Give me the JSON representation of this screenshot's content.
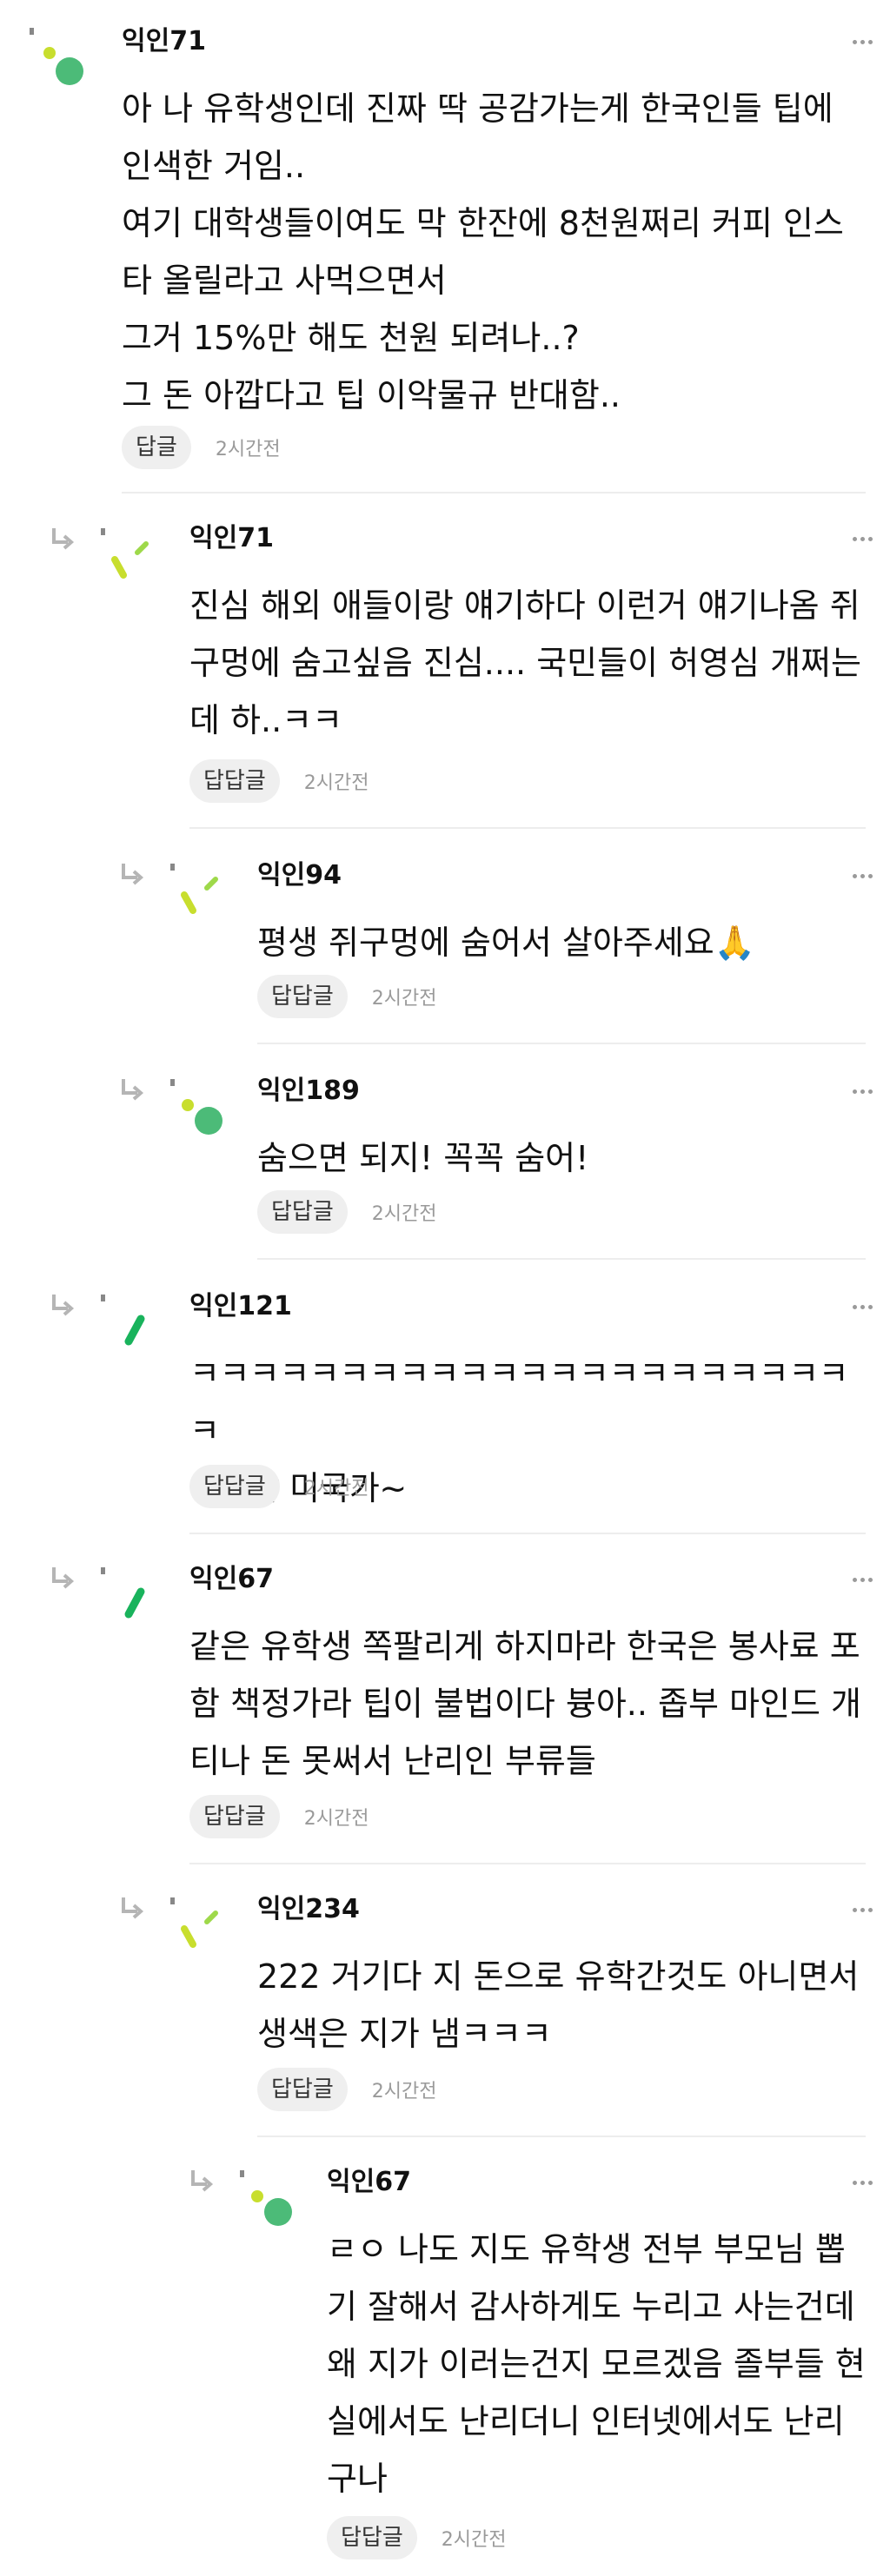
{
  "meta_label": "2시간전",
  "comments": [
    {
      "nick": "익인71",
      "lines": "아 나 유학생인데 진짜 딱 공감가는게 한국인들 팁에\n인색한 거임..\n여기 대학생들이여도 막 한잔에 8천원쩌리 커피 인스\n타 올릴라고 사먹으면서\n그거 15%만 해도 천원 되려나..?\n그 돈 아깝다고 팁 이악물규 반대함..",
      "reply_label": "답글",
      "time": "2시간전"
    },
    {
      "nick": "익인71",
      "lines": "진심 해외 애들이랑 얘기하다 이런거 얘기나옴 쥐\n구멍에 숨고싶음 진심.... 국민들이 허영심 개쩌는\n데 하..ㅋㅋ",
      "reply_label": "답답글",
      "time": "2시간전"
    },
    {
      "nick": "익인94",
      "lines": "평생 쥐구멍에 숨어서 살아주세요🙏",
      "reply_label": "답답글",
      "time": "2시간전"
    },
    {
      "nick": "익인189",
      "lines": "숨으면 되지! 꼭꼭 숨어!",
      "reply_label": "답답글",
      "time": "2시간전"
    },
    {
      "nick": "익인121",
      "lines": "ㅋㅋㅋㅋㅋㅋㅋㅋㅋㅋㅋㅋㅋㅋㅋㅋㅋㅋㅋㅋㅋㅋㅋ\nㅋ야야 미국가~",
      "reply_label": "답답글",
      "time": "2시간전"
    },
    {
      "nick": "익인67",
      "lines": "같은 유학생 쪽팔리게 하지마라 한국은 봉사료 포\n함 책정가라 팁이 불법이다 븅아.. 좁부 마인드 개\n티나 돈 못써서 난리인 부류들",
      "reply_label": "답답글",
      "time": "2시간전"
    },
    {
      "nick": "익인234",
      "lines": "222 거기다 지 돈으로 유학간것도 아니면서\n생색은 지가 냄ㅋㅋㅋ",
      "reply_label": "답답글",
      "time": "2시간전"
    },
    {
      "nick": "익인67",
      "lines": "ㄹㅇ 나도 지도 유학생 전부 부모님 뽑\n기 잘해서 감사하게도 누리고 사는건데\n왜 지가 이러는건지 모르겠음 졸부들 현\n실에서도 난리더니 인터넷에서도 난리\n구나",
      "reply_label": "답답글",
      "time": "2시간전"
    }
  ],
  "icons": {
    "reply_arrow": "reply-arrow-icon",
    "more": "more-options-icon",
    "avatar_a": "avatar-green-circle",
    "avatar_b": "avatar-yellow-lines",
    "avatar_c": "avatar-green-stroke"
  },
  "colors": {
    "avatar_green": "#4cbb78",
    "avatar_lime": "#c8de2e",
    "avatar_stroke": "#19b35c",
    "divider": "#ededed",
    "time": "#9a9a9a"
  }
}
